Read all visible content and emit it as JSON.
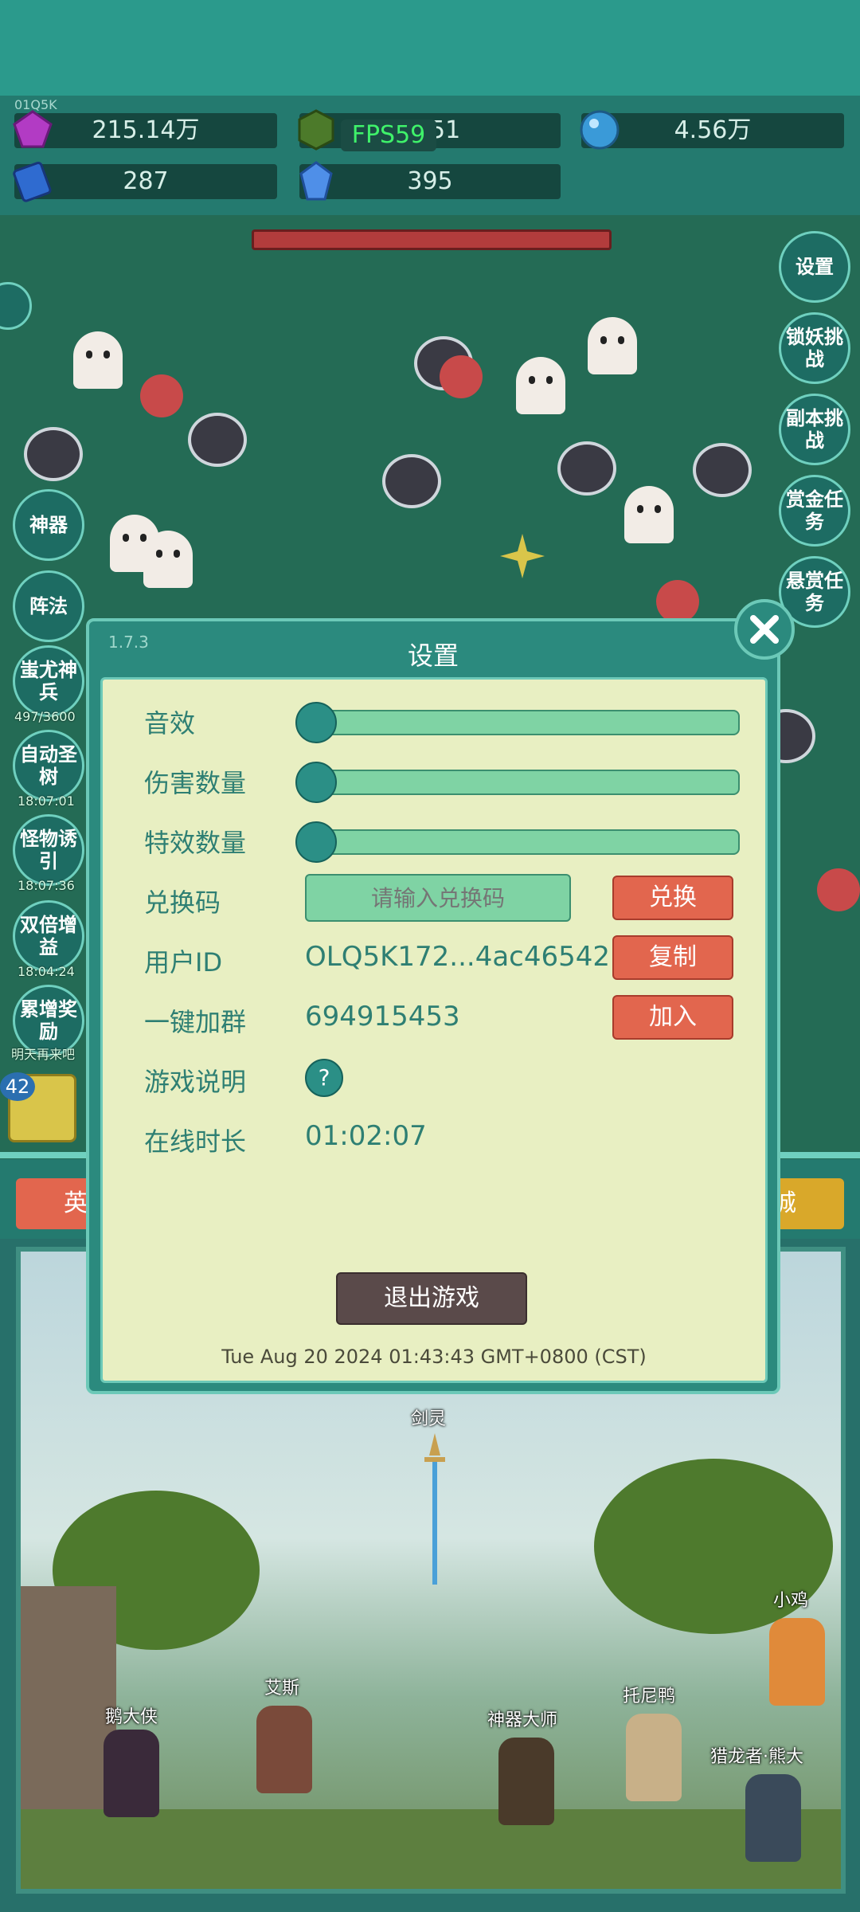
{
  "resources": {
    "gem": "215.14万",
    "fps": "FPS59",
    "green_gem": "1351",
    "orb": "4.56万",
    "book": "287",
    "crystal": "395",
    "tiny_label": "01Q5K"
  },
  "side_left": [
    {
      "label": "神器"
    },
    {
      "label": "阵法"
    },
    {
      "label": "蚩尤神兵",
      "timer": "497/3600"
    },
    {
      "label": "自动圣树",
      "timer": "18:07:01"
    },
    {
      "label": "怪物诱引",
      "timer": "18:07:36"
    },
    {
      "label": "双倍增益",
      "timer": "18:04:24"
    },
    {
      "label": "累增奖励",
      "timer": "明天再来吧"
    }
  ],
  "side_right": [
    {
      "label": "设置"
    },
    {
      "label": "锁妖挑战"
    },
    {
      "label": "副本挑战"
    },
    {
      "label": "赏金任务"
    },
    {
      "label": "悬赏任务"
    }
  ],
  "bottom_tabs": {
    "left": "英",
    "right": "城",
    "badge1": "42"
  },
  "scene_names": [
    "剑灵",
    "小鸡",
    "艾斯",
    "鹅大侠",
    "托尼鸭",
    "神器大师",
    "猎龙者·熊大"
  ],
  "dialog": {
    "version": "1.7.3",
    "title": "设置",
    "close_icon": "close-icon",
    "rows": {
      "sound": "音效",
      "damage_count": "伤害数量",
      "effect_count": "特效数量",
      "redeem_code": "兑换码",
      "user_id": "用户ID",
      "join_group": "一键加群",
      "game_help": "游戏说明",
      "online_time": "在线时长"
    },
    "sliders": {
      "sound": 0,
      "damage_count": 0,
      "effect_count": 0
    },
    "redeem_placeholder": "请输入兑换码",
    "redeem_button": "兑换",
    "user_id_value": "OLQ5K172...4ac46542",
    "copy_button": "复制",
    "group_value": "694915453",
    "join_button": "加入",
    "help_icon": "?",
    "online_value": "01:02:07",
    "exit_button": "退出游戏",
    "timestamp": "Tue Aug 20 2024 01:43:43 GMT+0800 (CST)"
  },
  "colors": {
    "accent": "#2b8a7e",
    "button_red": "#e2664e",
    "panel": "#e8efc2"
  }
}
